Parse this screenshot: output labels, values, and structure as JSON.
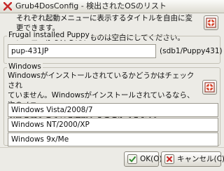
{
  "window": {
    "title": "Grub4DosConfig - 検出されたOSのリスト",
    "icon": "x-app-icon"
  },
  "description": "それぞれ起動メニューに表示するタイトルを自由に変更できます。メニューから外したいものは空白にしてください。",
  "frugal": {
    "label": "Frugal installed Puppy",
    "value": "pup-431JP",
    "location": "(sdb1/Puppy431)"
  },
  "windows": {
    "label": "Windows",
    "info": "Windowsがインストールされているかどうかはチェックされていません。Windowsがインストールされているなら、次のメニュー項目を使うとそれを起動することができます。",
    "entries": [
      "Windows Vista/2008/7",
      "Windows NT/2000/XP",
      "Windows 9x/Me"
    ]
  },
  "buttons": {
    "ok_label": "OK(O)",
    "cancel_label": "キャンセル(C)"
  },
  "colors": {
    "help_icon_red": "#d8442a",
    "ok_check": "#2e8b2e",
    "cancel_red": "#cc2222"
  }
}
